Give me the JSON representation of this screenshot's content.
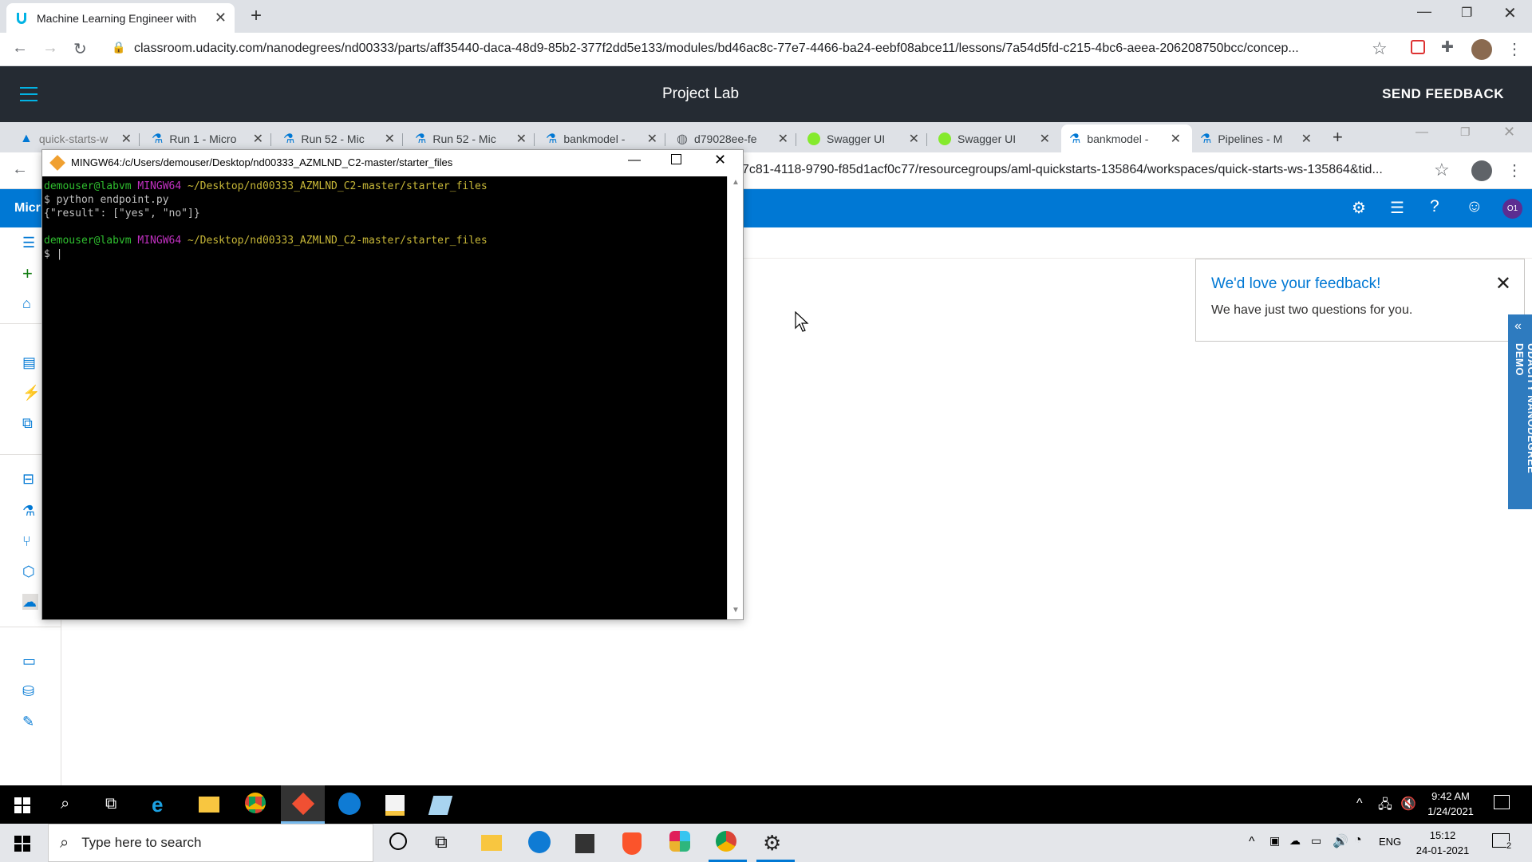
{
  "outer_browser": {
    "tab_title": "Machine Learning Engineer with",
    "url": "classroom.udacity.com/nanodegrees/nd00333/parts/aff35440-daca-48d9-85b2-377f2dd5e133/modules/bd46ac8c-77e7-4466-ba24-eebf08abce11/lessons/7a54d5fd-c215-4bc6-aeea-206208750bcc/concep..."
  },
  "project_lab": {
    "title": "Project Lab",
    "feedback_label": "SEND FEEDBACK"
  },
  "inner_browser": {
    "tabs": [
      {
        "label": "quick-starts-w"
      },
      {
        "label": "Run 1 - Micro"
      },
      {
        "label": "Run 52 - Mic"
      },
      {
        "label": "Run 52 - Mic"
      },
      {
        "label": "bankmodel -"
      },
      {
        "label": "d79028ee-fe"
      },
      {
        "label": "Swagger UI"
      },
      {
        "label": "Swagger UI"
      },
      {
        "label": "bankmodel -"
      },
      {
        "label": "Pipelines - M"
      }
    ],
    "url": "7c81-4118-9790-f85d1acf0c77/resourcegroups/aml-quickstarts-135864/workspaces/quick-starts-ws-135864&tid...",
    "azure_brand": "Micr",
    "avatar_initials": "O1"
  },
  "feedback_card": {
    "title": "We'd love your feedback!",
    "text": "We have just two questions for you."
  },
  "demo_tab": {
    "label": "UDACITY NANODEGREE DEMO"
  },
  "terminal": {
    "title": "MINGW64:/c/Users/demouser/Desktop/nd00333_AZMLND_C2-master/starter_files",
    "prompt_user": "demouser@labvm",
    "prompt_env": "MINGW64",
    "prompt_path": "~/Desktop/nd00333_AZMLND_C2-master/starter_files",
    "command": "$ python endpoint.py",
    "output": "{\"result\": [\"yes\", \"no\"]}",
    "cursor_line": "$ |"
  },
  "taskbar1": {
    "time": "9:42 AM",
    "date": "1/24/2021"
  },
  "taskbar2": {
    "search_placeholder": "Type here to search",
    "language": "ENG",
    "time": "15:12",
    "date": "24-01-2021",
    "notification_count": "2"
  },
  "colors": {
    "azure_blue": "#0078d4",
    "udacity_dark": "#252b33",
    "demo_tab": "#2e7bbf"
  }
}
